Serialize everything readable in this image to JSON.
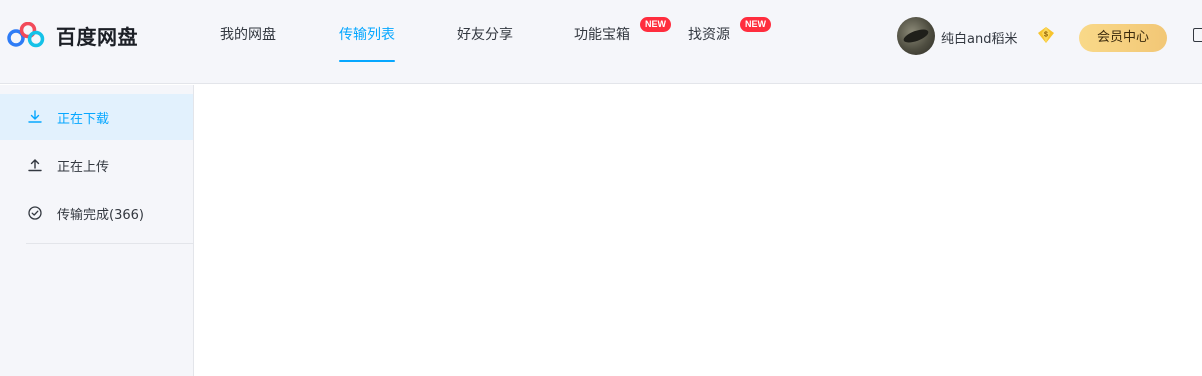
{
  "app": {
    "name": "百度网盘",
    "brand_color": "#06a7ff"
  },
  "nav": {
    "items": [
      {
        "label": "我的网盘"
      },
      {
        "label": "传输列表",
        "active": true
      },
      {
        "label": "好友分享"
      },
      {
        "label": "功能宝箱",
        "badge": "NEW"
      },
      {
        "label": "找资源",
        "badge": "NEW"
      }
    ]
  },
  "user": {
    "name": "纯白and稻米",
    "svip_icon": "svip-diamond-icon",
    "vip_center_label": "会员中心"
  },
  "sidebar": {
    "items": [
      {
        "label": "正在下载",
        "icon": "download-icon",
        "active": true
      },
      {
        "label": "正在上传",
        "icon": "upload-icon"
      },
      {
        "label": "传输完成(366)",
        "icon": "check-circle-icon"
      }
    ]
  }
}
